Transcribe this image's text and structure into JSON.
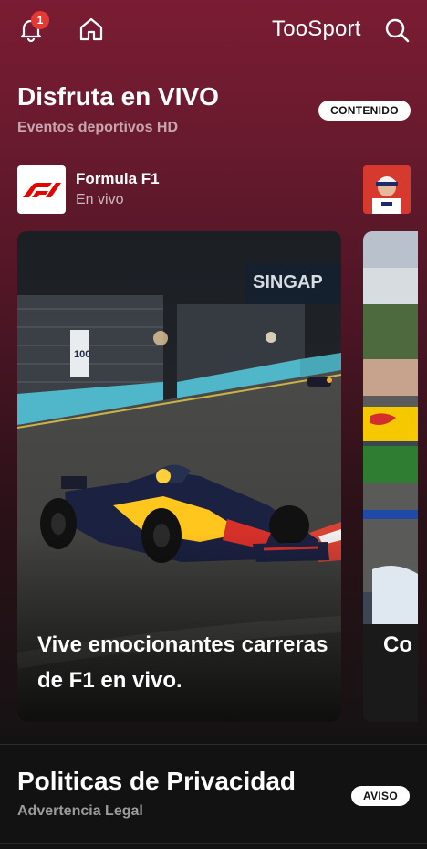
{
  "header": {
    "notification_count": "1",
    "brand": "TooSport"
  },
  "live_section": {
    "title": "Disfruta en VIVO",
    "subtitle": "Eventos deportivos HD",
    "tag": "CONTENIDO"
  },
  "channel": {
    "name": "Formula F1",
    "status": "En vivo"
  },
  "cards": [
    {
      "caption": "Vive emocionantes carreras de F1 en vivo."
    },
    {
      "caption": "Co ev"
    }
  ],
  "legal_section": {
    "title": "Politicas de Privacidad",
    "subtitle": "Advertencia Legal",
    "tag": "AVISO"
  },
  "scene_signs": {
    "banner": "SINGAP",
    "marker": "100"
  },
  "colors": {
    "header_gradient_top": "#7a1c33",
    "accent_red": "#e53935",
    "background": "#121212"
  }
}
